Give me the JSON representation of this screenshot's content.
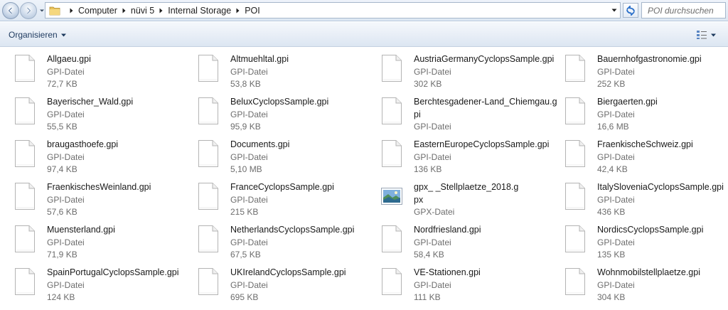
{
  "address_bar": {
    "breadcrumbs": [
      "Computer",
      "nüvi 5",
      "Internal Storage",
      "POI"
    ],
    "search_placeholder": "POI durchsuchen"
  },
  "toolbar": {
    "organize_label": "Organisieren"
  },
  "files": [
    {
      "name": "Allgaeu.gpi",
      "type": "GPI-Datei",
      "size": "72,7 KB",
      "icon": "blank-file-icon"
    },
    {
      "name": "Altmuehltal.gpi",
      "type": "GPI-Datei",
      "size": "53,8 KB",
      "icon": "blank-file-icon"
    },
    {
      "name": "AustriaGermanyCyclopsSample.gpi",
      "type": "GPI-Datei",
      "size": "302 KB",
      "icon": "blank-file-icon"
    },
    {
      "name": "Bauernhofgastronomie.gpi",
      "type": "GPI-Datei",
      "size": "252 KB",
      "icon": "blank-file-icon"
    },
    {
      "name": "Bayerischer_Wald.gpi",
      "type": "GPI-Datei",
      "size": "55,5 KB",
      "icon": "blank-file-icon"
    },
    {
      "name": "BeluxCyclopsSample.gpi",
      "type": "GPI-Datei",
      "size": "95,9 KB",
      "icon": "blank-file-icon"
    },
    {
      "name": "Berchtesgadener-Land_Chiemgau.gpi",
      "type": "GPI-Datei",
      "size": "",
      "icon": "blank-file-icon",
      "wrap": "Berchtesgadener-Land_Chiemgau.g|pi"
    },
    {
      "name": "Biergaerten.gpi",
      "type": "GPI-Datei",
      "size": "16,6 MB",
      "icon": "blank-file-icon"
    },
    {
      "name": "braugasthoefe.gpi",
      "type": "GPI-Datei",
      "size": "97,4 KB",
      "icon": "blank-file-icon"
    },
    {
      "name": "Documents.gpi",
      "type": "GPI-Datei",
      "size": "5,10 MB",
      "icon": "blank-file-icon"
    },
    {
      "name": "EasternEuropeCyclopsSample.gpi",
      "type": "GPI-Datei",
      "size": "136 KB",
      "icon": "blank-file-icon"
    },
    {
      "name": "FraenkischeSchweiz.gpi",
      "type": "GPI-Datei",
      "size": "42,4 KB",
      "icon": "blank-file-icon"
    },
    {
      "name": "FraenkischesWeinland.gpi",
      "type": "GPI-Datei",
      "size": "57,6 KB",
      "icon": "blank-file-icon"
    },
    {
      "name": "FranceCyclopsSample.gpi",
      "type": "GPI-Datei",
      "size": "215 KB",
      "icon": "blank-file-icon"
    },
    {
      "name": "gpx_          _Stellplaetze_2018.gpx",
      "type": "GPX-Datei",
      "size": "",
      "icon": "image-file-icon",
      "wrap": "gpx_          _Stellplaetze_2018.g|px"
    },
    {
      "name": "ItalySloveniaCyclopsSample.gpi",
      "type": "GPI-Datei",
      "size": "436 KB",
      "icon": "blank-file-icon"
    },
    {
      "name": "Muensterland.gpi",
      "type": "GPI-Datei",
      "size": "71,9 KB",
      "icon": "blank-file-icon"
    },
    {
      "name": "NetherlandsCyclopsSample.gpi",
      "type": "GPI-Datei",
      "size": "67,5 KB",
      "icon": "blank-file-icon"
    },
    {
      "name": "Nordfriesland.gpi",
      "type": "GPI-Datei",
      "size": "58,4 KB",
      "icon": "blank-file-icon"
    },
    {
      "name": "NordicsCyclopsSample.gpi",
      "type": "GPI-Datei",
      "size": "135 KB",
      "icon": "blank-file-icon"
    },
    {
      "name": "SpainPortugalCyclopsSample.gpi",
      "type": "GPI-Datei",
      "size": "124 KB",
      "icon": "blank-file-icon"
    },
    {
      "name": "UKIrelandCyclopsSample.gpi",
      "type": "GPI-Datei",
      "size": "695 KB",
      "icon": "blank-file-icon"
    },
    {
      "name": "VE-Stationen.gpi",
      "type": "GPI-Datei",
      "size": "111 KB",
      "icon": "blank-file-icon"
    },
    {
      "name": "Wohnmobilstellplaetze.gpi",
      "type": "GPI-Datei",
      "size": "304 KB",
      "icon": "blank-file-icon"
    }
  ]
}
